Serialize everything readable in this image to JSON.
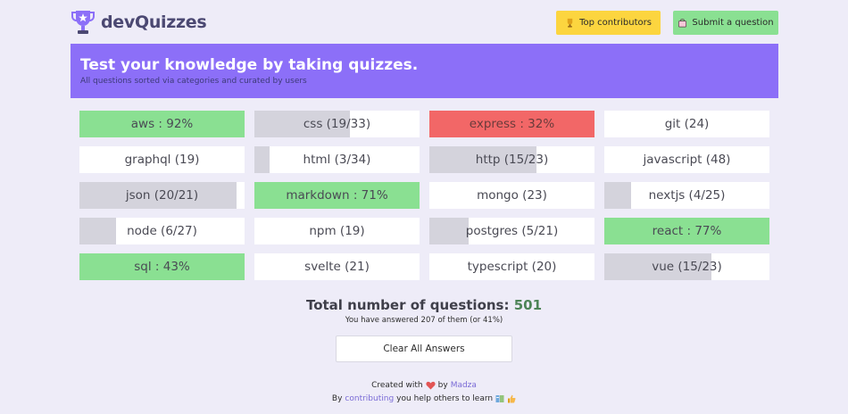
{
  "header": {
    "brand": "devQuizzes",
    "top_contributors_label": "Top contributors",
    "submit_question_label": "Submit a question",
    "top_icon": "trophy-icon",
    "submit_icon": "bag-icon"
  },
  "banner": {
    "title": "Test your knowledge by taking quizzes.",
    "subtitle": "All questions sorted via categories and curated by users"
  },
  "categories": [
    {
      "label": "aws : 92%",
      "state": "pass",
      "progress": 1.0
    },
    {
      "label": "css (19/33)",
      "state": "progress",
      "progress": 0.58
    },
    {
      "label": "express : 32%",
      "state": "fail",
      "progress": 1.0
    },
    {
      "label": "git (24)",
      "state": "none",
      "progress": 0
    },
    {
      "label": "graphql (19)",
      "state": "none",
      "progress": 0
    },
    {
      "label": "html (3/34)",
      "state": "progress",
      "progress": 0.09
    },
    {
      "label": "http (15/23)",
      "state": "progress",
      "progress": 0.65
    },
    {
      "label": "javascript (48)",
      "state": "none",
      "progress": 0
    },
    {
      "label": "json (20/21)",
      "state": "progress",
      "progress": 0.95
    },
    {
      "label": "markdown : 71%",
      "state": "pass",
      "progress": 1.0
    },
    {
      "label": "mongo (23)",
      "state": "none",
      "progress": 0
    },
    {
      "label": "nextjs (4/25)",
      "state": "progress",
      "progress": 0.16
    },
    {
      "label": "node (6/27)",
      "state": "progress",
      "progress": 0.22
    },
    {
      "label": "npm (19)",
      "state": "none",
      "progress": 0
    },
    {
      "label": "postgres (5/21)",
      "state": "progress",
      "progress": 0.24
    },
    {
      "label": "react : 77%",
      "state": "pass",
      "progress": 1.0
    },
    {
      "label": "sql : 43%",
      "state": "pass",
      "progress": 1.0
    },
    {
      "label": "svelte (21)",
      "state": "none",
      "progress": 0
    },
    {
      "label": "typescript (20)",
      "state": "none",
      "progress": 0
    },
    {
      "label": "vue (15/23)",
      "state": "progress",
      "progress": 0.65
    }
  ],
  "summary": {
    "total_label": "Total number of questions:",
    "total_value": "501",
    "answered_text": "You have answered 207 of them (or 41%)",
    "clear_label": "Clear All Answers"
  },
  "footer": {
    "created_with": "Created with",
    "by": "by",
    "author": "Madza",
    "line2_prefix": "By",
    "contributing": "contributing",
    "line2_suffix": "you help others to learn"
  },
  "colors": {
    "accent": "#8c6ff8",
    "pass": "#8ae092",
    "fail": "#f26767",
    "progress": "#d4d3dc",
    "yellow_button": "#fcd53f"
  }
}
